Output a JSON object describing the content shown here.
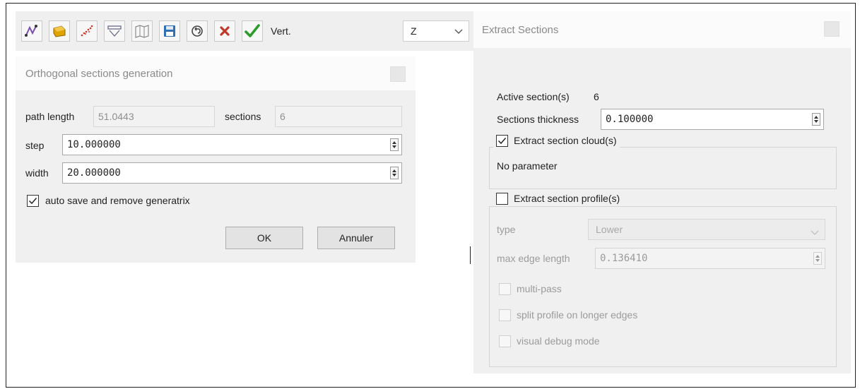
{
  "toolbar": {
    "icons": [
      "polyline-icon",
      "import-icon",
      "points-icon",
      "section-icon",
      "unfold-icon",
      "save-icon",
      "undo-icon",
      "cancel-icon",
      "validate-icon"
    ],
    "vert_label": "Vert.",
    "axis_value": "Z"
  },
  "ortho": {
    "title": "Orthogonal sections generation",
    "path_length_label": "path length",
    "path_length_value": "51.0443",
    "sections_label": "sections",
    "sections_value": "6",
    "step_label": "step",
    "step_value": "10.000000",
    "width_label": "width",
    "width_value": "20.000000",
    "auto_save_label": "auto save and remove generatrix",
    "auto_save_checked": true,
    "ok_label": "OK",
    "cancel_label": "Annuler"
  },
  "extract": {
    "title": "Extract Sections",
    "active_label": "Active section(s)",
    "active_value": "6",
    "thickness_label": "Sections thickness",
    "thickness_value": "0.100000",
    "cloud_label": "Extract section cloud(s)",
    "cloud_checked": true,
    "no_parameter": "No parameter",
    "profile_label": "Extract section profile(s)",
    "profile_checked": false,
    "type_label": "type",
    "type_value": "Lower",
    "max_edge_label": "max edge length",
    "max_edge_value": "0.136410",
    "multipass_label": "multi-pass",
    "split_label": "split profile on longer edges",
    "debug_label": "visual debug mode"
  },
  "colors": {
    "validate": "#2e9a2e",
    "cancel": "#c0392b",
    "import": "#e0a400",
    "save": "#2f6fb5"
  }
}
